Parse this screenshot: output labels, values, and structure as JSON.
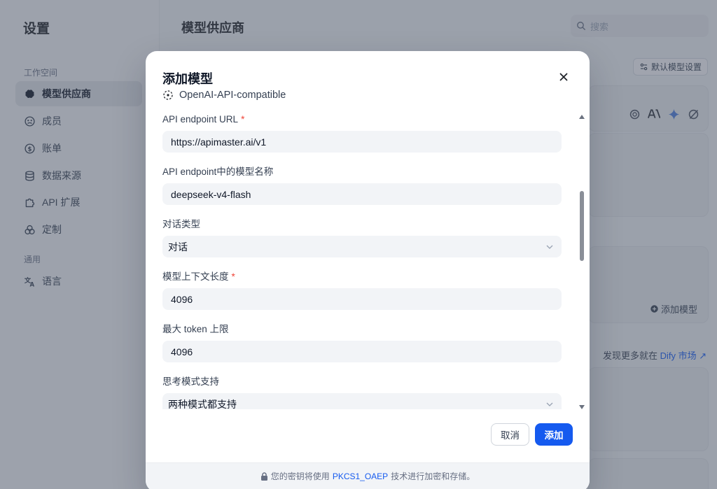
{
  "sidebar": {
    "title": "设置",
    "workspace_label": "工作空间",
    "general_label": "通用",
    "items": [
      {
        "label": "模型供应商",
        "icon": "brain-icon",
        "active": true
      },
      {
        "label": "成员",
        "icon": "members-icon"
      },
      {
        "label": "账单",
        "icon": "billing-icon"
      },
      {
        "label": "数据来源",
        "icon": "database-icon"
      },
      {
        "label": "API 扩展",
        "icon": "puzzle-icon"
      },
      {
        "label": "定制",
        "icon": "customize-icon"
      }
    ],
    "general_items": [
      {
        "label": "语言",
        "icon": "translate-icon"
      }
    ]
  },
  "main": {
    "page_title": "模型供应商",
    "search_placeholder": "搜索",
    "default_model_settings": "默认模型设置",
    "add_model": "添加模型",
    "market_prefix": "发现更多就在",
    "market_link": "Dify 市场 ↗",
    "provider_logos": [
      "openai-icon",
      "anthropic-icon",
      "gemini-icon",
      "other-provider-icon"
    ]
  },
  "modal": {
    "title": "添加模型",
    "provider_name": "OpenAI-API-compatible",
    "fields": {
      "endpoint_url": {
        "label": "API endpoint URL",
        "required": true,
        "value": "https://apimaster.ai/v1"
      },
      "model_name": {
        "label": "API endpoint中的模型名称",
        "value": "deepseek-v4-flash"
      },
      "dialog_type": {
        "label": "对话类型",
        "value": "对话"
      },
      "context_length": {
        "label": "模型上下文长度",
        "required": true,
        "value": "4096"
      },
      "max_tokens": {
        "label": "最大 token 上限",
        "value": "4096"
      },
      "thinking_mode": {
        "label": "思考模式支持",
        "value": "两种模式都支持"
      }
    },
    "cancel_label": "取消",
    "add_label": "添加",
    "footer": {
      "prefix": "您的密钥将使用",
      "link": "PKCS1_OAEP",
      "suffix": "技术进行加密和存储。"
    }
  },
  "colors": {
    "primary": "#155aef",
    "required": "#f04438",
    "input_bg": "#f2f4f7"
  }
}
